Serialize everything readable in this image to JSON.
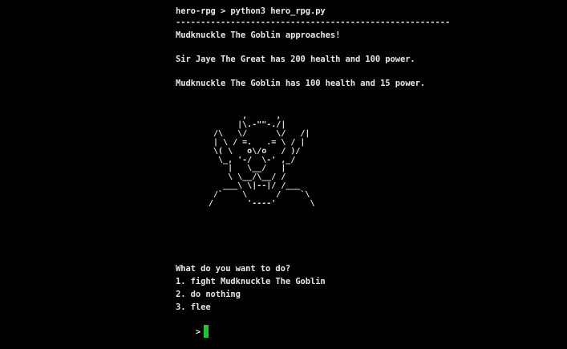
{
  "terminal": {
    "prompt_line": "hero-rpg > python3 hero_rpg.py",
    "separator": "-------------------------------------------------------",
    "approach_line": "Mudknuckle The Goblin approaches!",
    "hero_status": "Sir Jaye The Great has 200 health and 100 power.",
    "enemy_status": "Mudknuckle The Goblin has 100 health and 15 power.",
    "goblin_art": "        ,      ,\n       |\\.-\"\"-./|\n  /\\   \\/      \\/   /|\n  | \\ / =.   .= \\ / |\n  \\( \\   o\\/o   / )/\n   \\_, '-/  \\-' ,_/\n     |   \\__/   |\n     \\ \\__/\\__/ /\n    ___\\ \\|--|/ /___\n  /`    \\      /    `\\\n /       '----'       \\",
    "question": "What do you want to do?",
    "options": [
      "1. fight Mudknuckle The Goblin",
      "2. do nothing",
      "3. flee"
    ],
    "input_prompt": ">",
    "cursor_color": "#22c32e",
    "text_color": "#e6e6e6",
    "background_color": "#000000"
  }
}
